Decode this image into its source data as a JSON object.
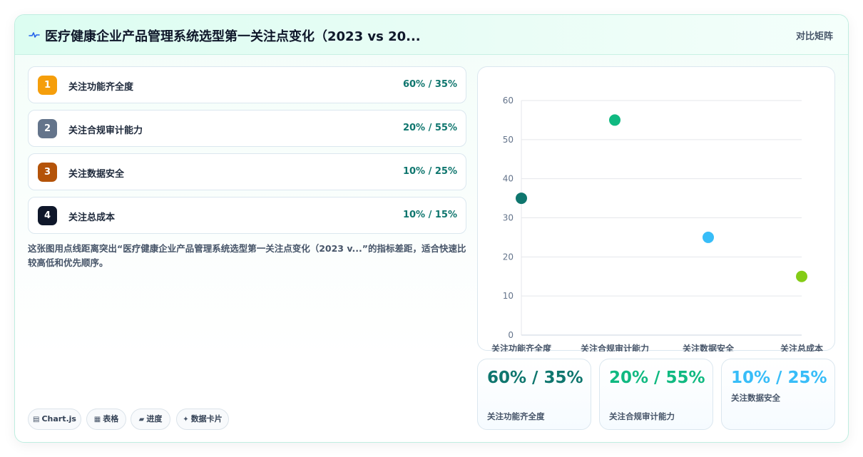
{
  "header": {
    "title": "医疗健康企业产品管理系统选型第一关注点变化（2023 vs 20...",
    "tag": "对比矩阵"
  },
  "ranking": [
    {
      "rank": "1",
      "label": "关注功能齐全度",
      "value": "60% / 35%",
      "color": "#f59e0b"
    },
    {
      "rank": "2",
      "label": "关注合规审计能力",
      "value": "20% / 55%",
      "color": "#64748b"
    },
    {
      "rank": "3",
      "label": "关注数据安全",
      "value": "10% / 25%",
      "color": "#b45309"
    },
    {
      "rank": "4",
      "label": "关注总成本",
      "value": "10% / 15%",
      "color": "#0f172a"
    }
  ],
  "description": "这张图用点线距离突出“医疗健康企业产品管理系统选型第一关注点变化（2023 v...”的指标差距，适合快速比较高低和优先顺序。",
  "chips": [
    {
      "icon": "▤",
      "label": "Chart.js"
    },
    {
      "icon": "▦",
      "label": "表格"
    },
    {
      "icon": "▰",
      "label": "进度"
    },
    {
      "icon": "✦",
      "label": "数据卡片"
    }
  ],
  "stats": [
    {
      "value": "60% / 35%",
      "label": "关注功能齐全度",
      "color": "#0f766e"
    },
    {
      "value": "20% / 55%",
      "label": "关注合规审计能力",
      "color": "#10b981"
    },
    {
      "value": "10% / 25%",
      "label": "关注数据安全",
      "color": "#38bdf8"
    }
  ],
  "chart_data": {
    "type": "scatter",
    "categories": [
      "关注功能齐全度",
      "关注合规审计能力",
      "关注数据安全",
      "关注总成本"
    ],
    "values": [
      35,
      55,
      25,
      15
    ],
    "point_colors": [
      "#0f766e",
      "#10b981",
      "#38bdf8",
      "#84cc16"
    ],
    "ylim": [
      0,
      60
    ],
    "yticks": [
      0,
      10,
      20,
      30,
      40,
      50,
      60
    ],
    "grid": true,
    "legend": "none"
  }
}
